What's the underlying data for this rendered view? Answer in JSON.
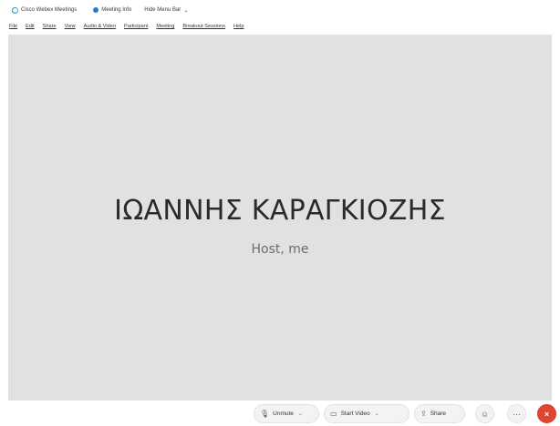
{
  "titlebar": {
    "app_name": "Cisco Webex Meetings",
    "meeting_info": "Meeting Info",
    "hide_menu": "Hide Menu Bar",
    "hide_menu_chevron": "⌄"
  },
  "menubar": {
    "items": [
      "File",
      "Edit",
      "Share",
      "View",
      "Audio & Video",
      "Participant",
      "Meeting",
      "Breakout Sessions",
      "Help"
    ]
  },
  "stage": {
    "participant_name": "ΙΩΑΝΝΗΣ ΚΑΡΑΓΚΙΟΖΗΣ",
    "participant_role": "Host, me"
  },
  "controls": {
    "unmute_label": "Unmute",
    "start_video_label": "Start Video",
    "share_label": "Share",
    "reactions_icon": "☺",
    "more_icon": "···",
    "leave_icon": "×",
    "mic_icon": "🎙",
    "video_icon": "▭",
    "share_icon": "⇪",
    "caret": "⌄"
  },
  "colors": {
    "stage_bg": "#e1e1e1",
    "leave_red": "#e0462f",
    "webex_blue": "#1a8fd8"
  }
}
